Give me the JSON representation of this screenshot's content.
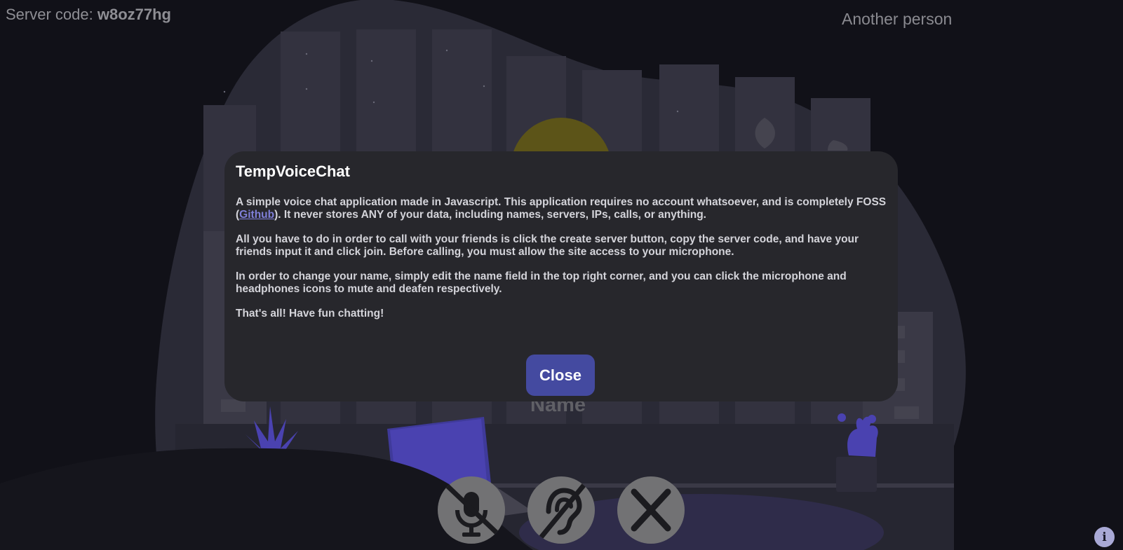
{
  "header": {
    "server_code_label": "Server code:",
    "server_code_value": "w8oz77hg",
    "other_participant": "Another person"
  },
  "self": {
    "name_label": "Name"
  },
  "controls": {
    "mute_icon": "microphone-slash-icon",
    "deafen_icon": "ear-slash-icon",
    "leave_icon": "x-close-icon"
  },
  "info_button": {
    "glyph": "i",
    "icon": "info-icon"
  },
  "modal": {
    "title": "TempVoiceChat",
    "p1_before": "A simple voice chat application made in Javascript. This application requires no account whatsoever, and is completely FOSS (",
    "p1_link": "Github",
    "p1_after": "). It never stores ANY of your data, including names, servers, IPs, calls, or anything.",
    "p2": "All you have to do in order to call with your friends is click the create server button, copy the server code, and have your friends input it and click join. Before calling, you must allow the site access to your microphone.",
    "p3": "In order to change your name, simply edit the name field in the top right corner, and you can click the microphone and headphones icons to mute and deafen respectively.",
    "p4": "That's all! Have fun chatting!",
    "close_label": "Close"
  },
  "colors": {
    "background": "#111118",
    "scene_blob": "#2a2a36",
    "modal_bg": "#27272c",
    "close_button": "#444aa0",
    "link": "#7f7fd8",
    "control_button": "#727274",
    "accent_purple": "#4a3fa0",
    "moon": "#5c5418"
  }
}
